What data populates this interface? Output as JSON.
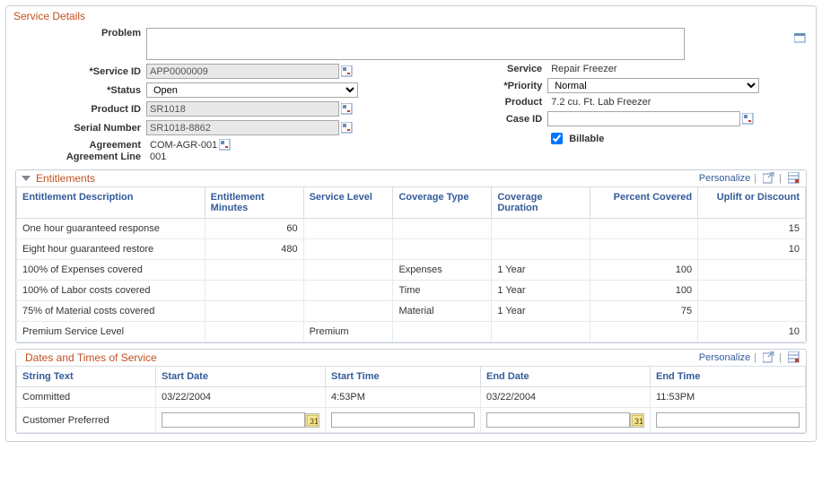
{
  "panel_title": "Service Details",
  "form": {
    "problem_label": "Problem",
    "problem_value": "",
    "service_id_label": "*Service ID",
    "service_id_value": "APP0000009",
    "status_label": "*Status",
    "status_value": "Open",
    "product_id_label": "Product ID",
    "product_id_value": "SR1018",
    "serial_label": "Serial Number",
    "serial_value": "SR1018-8862",
    "agreement_label": "Agreement",
    "agreement_value": "COM-AGR-001",
    "agreement_line_label": "Agreement Line",
    "agreement_line_value": "001",
    "service_label": "Service",
    "service_value": "Repair Freezer",
    "priority_label": "*Priority",
    "priority_value": "Normal",
    "product_label": "Product",
    "product_value": "7.2 cu. Ft. Lab Freezer",
    "case_id_label": "Case ID",
    "case_id_value": "",
    "billable_label": "Billable",
    "billable_checked": true
  },
  "entitlements": {
    "title": "Entitlements",
    "personalize": "Personalize",
    "headers": {
      "desc": "Entitlement Description",
      "minutes": "Entitlement Minutes",
      "level": "Service Level",
      "coverage": "Coverage Type",
      "duration": "Coverage Duration",
      "percent": "Percent Covered",
      "uplift": "Uplift or Discount"
    },
    "rows": [
      {
        "desc": "One hour guaranteed response",
        "minutes": "60",
        "level": "",
        "coverage": "",
        "duration": "",
        "percent": "",
        "uplift": "15"
      },
      {
        "desc": "Eight hour guaranteed restore",
        "minutes": "480",
        "level": "",
        "coverage": "",
        "duration": "",
        "percent": "",
        "uplift": "10"
      },
      {
        "desc": "100% of Expenses covered",
        "minutes": "",
        "level": "",
        "coverage": "Expenses",
        "duration": "1 Year",
        "percent": "100",
        "uplift": ""
      },
      {
        "desc": "100% of Labor costs covered",
        "minutes": "",
        "level": "",
        "coverage": "Time",
        "duration": "1 Year",
        "percent": "100",
        "uplift": ""
      },
      {
        "desc": "75% of Material costs covered",
        "minutes": "",
        "level": "",
        "coverage": "Material",
        "duration": "1 Year",
        "percent": "75",
        "uplift": ""
      },
      {
        "desc": "Premium Service Level",
        "minutes": "",
        "level": "Premium",
        "coverage": "",
        "duration": "",
        "percent": "",
        "uplift": "10"
      }
    ]
  },
  "dates": {
    "title": "Dates and Times of Service",
    "personalize": "Personalize",
    "headers": {
      "text": "String Text",
      "sd": "Start Date",
      "st": "Start Time",
      "ed": "End Date",
      "et": "End Time"
    },
    "rows": [
      {
        "text": "Committed",
        "sd": "03/22/2004",
        "st": "4:53PM",
        "ed": "03/22/2004",
        "et": "11:53PM",
        "editable": false
      },
      {
        "text": "Customer Preferred",
        "sd": "",
        "st": "",
        "ed": "",
        "et": "",
        "editable": true
      }
    ]
  }
}
